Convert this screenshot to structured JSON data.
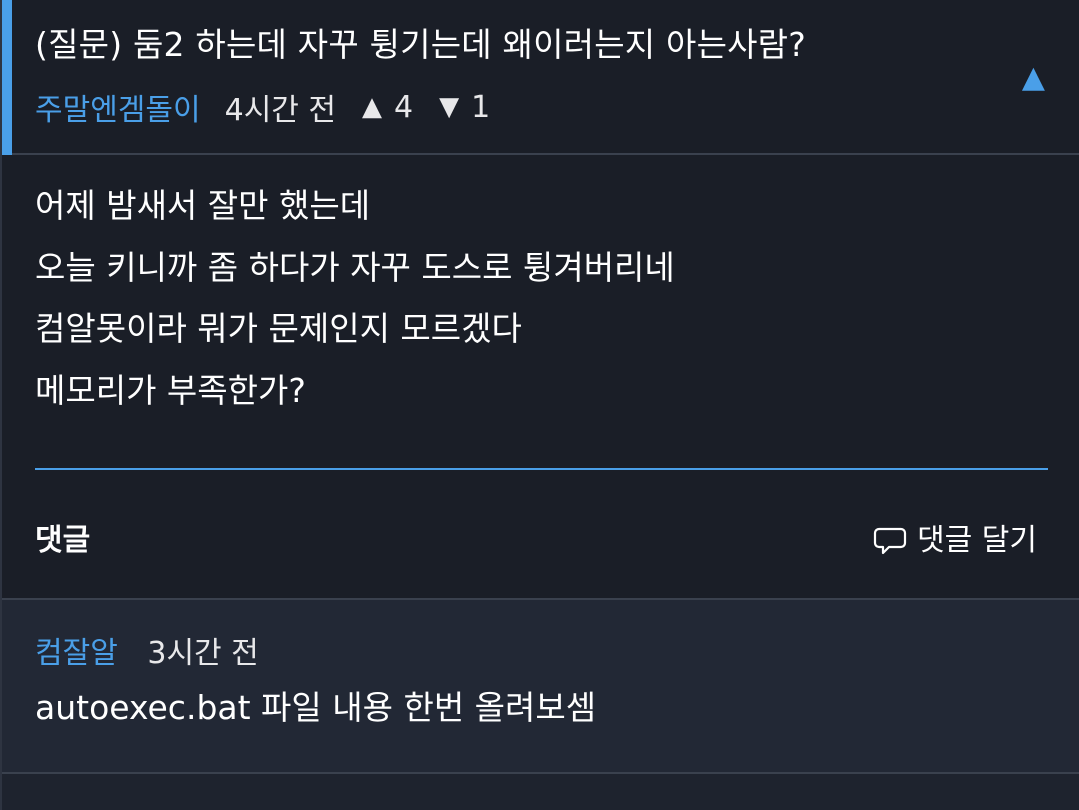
{
  "post": {
    "title": "(질문) 둠2 하는데 자꾸 튕기는데 왜이러는지 아는사람?",
    "author": "주말엔겜돌이",
    "time": "4시간 전",
    "upvotes": "4",
    "downvotes": "1",
    "upvote_glyph": "▲",
    "downvote_glyph": "▼",
    "collapse_glyph": "▲",
    "body_lines": [
      "어제 밤새서 잘만 했는데",
      "오늘 키니까 좀 하다가 자꾸 도스로 튕겨버리네",
      "컴알못이라 뭐가 문제인지 모르겠다",
      "메모리가 부족한가?"
    ]
  },
  "comments_section": {
    "title": "댓글",
    "add_comment_label": "댓글 달기",
    "add_comment_icon": "speech-bubble-icon"
  },
  "comments": [
    {
      "author": "컴잘알",
      "time": "3시간 전",
      "text": "autoexec.bat 파일 내용 한번 올려보셈"
    }
  ],
  "colors": {
    "background": "#1a1e27",
    "accent": "#4a9fe8",
    "comment_background": "#222835",
    "divider": "#3a414e"
  }
}
